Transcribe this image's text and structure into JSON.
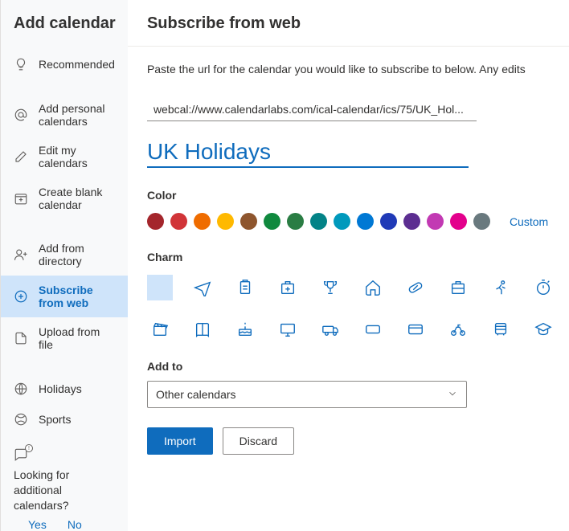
{
  "sidebar": {
    "title": "Add calendar",
    "items": [
      {
        "label": "Recommended"
      },
      {
        "label": "Add personal calendars"
      },
      {
        "label": "Edit my calendars"
      },
      {
        "label": "Create blank calendar"
      },
      {
        "label": "Add from directory"
      },
      {
        "label": "Subscribe from web"
      },
      {
        "label": "Upload from file"
      },
      {
        "label": "Holidays"
      },
      {
        "label": "Sports"
      }
    ],
    "footer_question": "Looking for additional calendars?",
    "yes_label": "Yes",
    "no_label": "No"
  },
  "main": {
    "title": "Subscribe from web",
    "helper": "Paste the url for the calendar you would like to subscribe to below. Any edits",
    "url_value": "webcal://www.calendarlabs.com/ical-calendar/ics/75/UK_Hol...",
    "name_value": "UK Holidays",
    "color_label": "Color",
    "custom_label": "Custom",
    "colors": [
      "#a4262c",
      "#d13438",
      "#ef6c00",
      "#ffb900",
      "#8e562e",
      "#10893e",
      "#2a7d44",
      "#038387",
      "#0099bc",
      "#0078d4",
      "#203ab7",
      "#5c2e91",
      "#c239b3",
      "#e3008c",
      "#69797e"
    ],
    "charm_label": "Charm",
    "addto_label": "Add to",
    "addto_value": "Other calendars",
    "import_label": "Import",
    "discard_label": "Discard"
  }
}
